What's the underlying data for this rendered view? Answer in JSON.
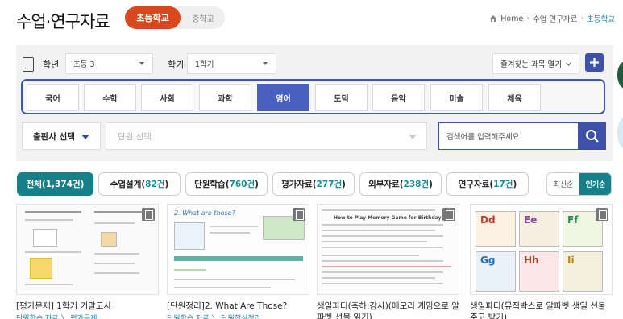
{
  "header": {
    "title": "수업·연구자료",
    "levels": [
      {
        "label": "초등학교",
        "active": true
      },
      {
        "label": "중학교",
        "active": false
      }
    ],
    "breadcrumb": {
      "home": "Home",
      "section": "수업·연구자료",
      "current": "초등학교"
    }
  },
  "filters": {
    "grade_label": "학년",
    "grade_value": "초등 3",
    "term_label": "학기",
    "term_value": "1학기",
    "favorites_label": "즐겨찾는 과목 열기",
    "subjects": [
      {
        "label": "국어",
        "active": false
      },
      {
        "label": "수학",
        "active": false
      },
      {
        "label": "사회",
        "active": false
      },
      {
        "label": "과학",
        "active": false
      },
      {
        "label": "영어",
        "active": true
      },
      {
        "label": "도덕",
        "active": false
      },
      {
        "label": "음악",
        "active": false
      },
      {
        "label": "미술",
        "active": false
      },
      {
        "label": "체육",
        "active": false
      }
    ],
    "publisher_label": "출판사 선택",
    "unit_placeholder": "단원 선택",
    "search_placeholder": "검색어를 입력해주세요"
  },
  "tabs": [
    {
      "label": "전체",
      "count": "1,374",
      "active": true
    },
    {
      "label": "수업설계",
      "count": "82",
      "active": false
    },
    {
      "label": "단원학습",
      "count": "760",
      "active": false
    },
    {
      "label": "평가자료",
      "count": "277",
      "active": false
    },
    {
      "label": "외부자료",
      "count": "238",
      "active": false
    },
    {
      "label": "연구자료",
      "count": "17",
      "active": false
    }
  ],
  "count_suffix": "건",
  "sort": {
    "latest": "최신순",
    "popular": "인기순",
    "active": "popular"
  },
  "cards": [
    {
      "title": "[평가문제] 1학기 기말고사",
      "category": "단원학습 자료 〉 평가문제",
      "thumb_heading": "",
      "icon": "document-icon"
    },
    {
      "title": "[단원정리]2. What Are Those?",
      "category": "단원학습 자료 〉 단원핵심정리",
      "thumb_heading": "2. What are those?",
      "icon": "image-icon"
    },
    {
      "title": "생일파티(축하,감사)(메모리 게임으로 알파벳 선물 읽기)",
      "category": "",
      "thumb_heading": "How to Play Memory Game for Birthday",
      "icon": "document-icon"
    },
    {
      "title": "생일파티(뮤직박스로 알파벳 생일 선물 주고 받기)",
      "category": "",
      "thumb_heading": "",
      "icon": "document-icon"
    }
  ],
  "colors": {
    "accent_orange": "#d9471c",
    "accent_blue": "#3d51a8",
    "accent_teal": "#16808a"
  }
}
